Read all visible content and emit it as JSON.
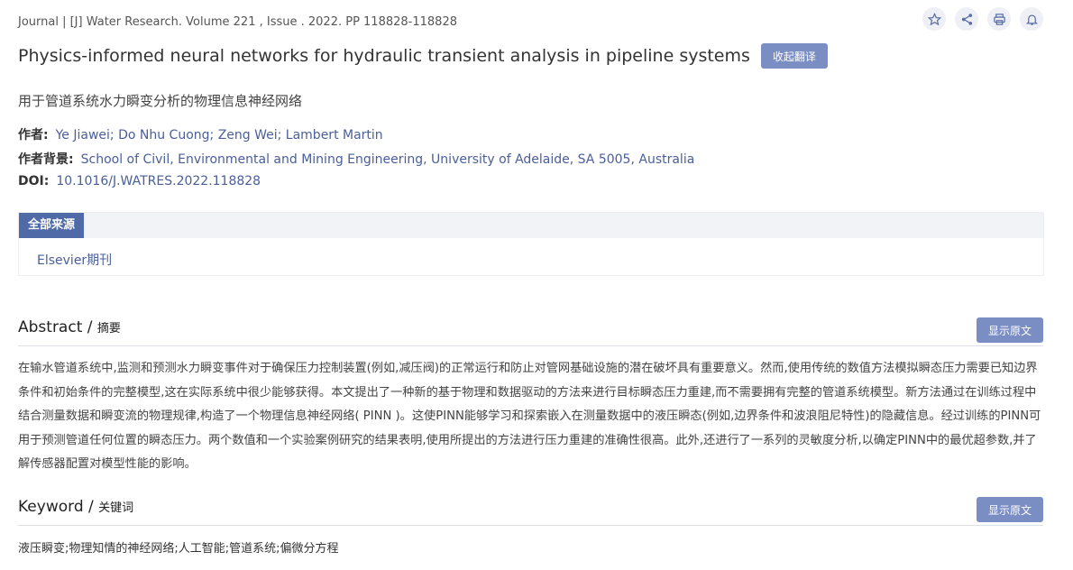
{
  "meta": "Journal | [J] Water Research. Volume 221 , Issue . 2022. PP 118828-118828",
  "icons": [
    "star-icon",
    "share-icon",
    "print-icon",
    "bell-icon"
  ],
  "title": "Physics-informed neural networks for hydraulic transient analysis in pipeline systems",
  "collapse_translate_label": "收起翻译",
  "subtitle_cn": "用于管道系统水力瞬变分析的物理信息神经网络",
  "authors": {
    "label": "作者:",
    "value": "Ye Jiawei; Do Nhu Cuong; Zeng Wei; Lambert Martin"
  },
  "affiliation": {
    "label": "作者背景:",
    "value": "School of Civil, Environmental and Mining Engineering, University of Adelaide, SA 5005, Australia"
  },
  "doi": {
    "label": "DOI:",
    "value": "10.1016/J.WATRES.2022.118828"
  },
  "sources": {
    "tab_label": "全部来源",
    "item": "Elsevier期刊"
  },
  "abstract": {
    "title": "Abstract / ",
    "title_cn": "摘要",
    "show_label": "显示原文",
    "text": "在输水管道系统中,监测和预测水力瞬变事件对于确保压力控制装置(例如,减压阀)的正常运行和防止对管网基础设施的潜在破坏具有重要意义。然而,使用传统的数值方法模拟瞬态压力需要已知边界条件和初始条件的完整模型,这在实际系统中很少能够获得。本文提出了一种新的基于物理和数据驱动的方法来进行目标瞬态压力重建,而不需要拥有完整的管道系统模型。新方法通过在训练过程中结合测量数据和瞬变流的物理规律,构造了一个物理信息神经网络( PINN )。这使PINN能够学习和探索嵌入在测量数据中的液压瞬态(例如,边界条件和波浪阻尼特性)的隐藏信息。经过训练的PINN可用于预测管道任何位置的瞬态压力。两个数值和一个实验案例研究的结果表明,使用所提出的方法进行压力重建的准确性很高。此外,还进行了一系列的灵敏度分析,以确定PINN中的最优超参数,并了解传感器配置对模型性能的影响。"
  },
  "keyword": {
    "title": "Keyword / ",
    "title_cn": "关键词",
    "show_label": "显示原文",
    "text": "液压瞬变;物理知情的神经网络;人工智能;管道系统;偏微分方程"
  }
}
